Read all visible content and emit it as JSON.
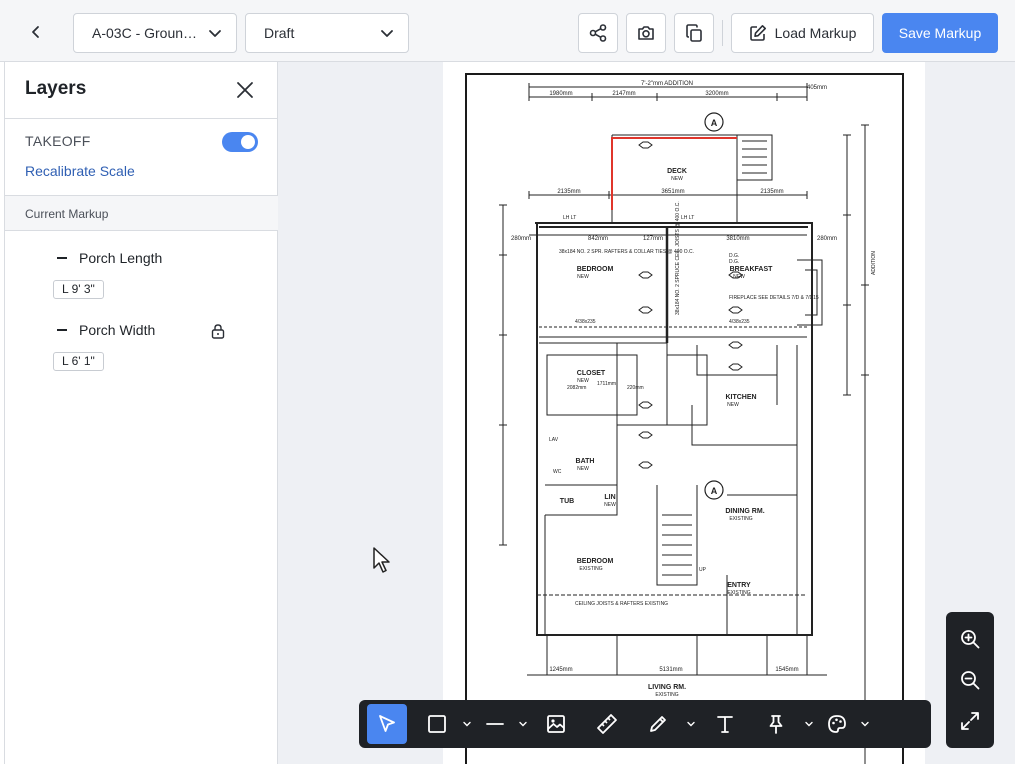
{
  "header": {
    "sheet_select": "A-03C - Groun…",
    "status_select": "Draft",
    "load_label": "Load Markup",
    "save_label": "Save Markup"
  },
  "panel": {
    "title": "Layers",
    "takeoff_label": "TAKEOFF",
    "takeoff_enabled": true,
    "recalibrate_label": "Recalibrate Scale",
    "section_label": "Current Markup",
    "markups": [
      {
        "name": "Porch Length",
        "measure": "L 9' 3\"",
        "locked": false
      },
      {
        "name": "Porch Width",
        "measure": "L 6' 1\"",
        "locked": true
      }
    ]
  },
  "drawing": {
    "dims_top": [
      "7'-2\"mm ADDITION",
      "1980mm",
      "2147mm",
      "3200mm",
      "405mm",
      "2135mm",
      "3651mm",
      "2135mm",
      "842mm",
      "3810mm",
      "127mm",
      "280mm",
      "280mm",
      "1245mm",
      "5131mm",
      "1545mm"
    ],
    "rooms": [
      "DECK",
      "BEDROOM",
      "BREAKFAST",
      "CLOSET",
      "KITCHEN",
      "BATH",
      "LIN",
      "TUB",
      "DINING RM.",
      "BEDROOM",
      "ENTRY",
      "LIVING RM."
    ],
    "room_subs": [
      "NEW",
      "NEW",
      "NEW",
      "NEW",
      "NEW",
      "NEW",
      "NEW",
      "EXISTING",
      "EXISTING",
      "EXISTING",
      "EXISTING"
    ],
    "notes": [
      "38x184 NO. 2 SPR. RAFTERS & COLLAR TIES @ 400 O.C.",
      "38x184 NO. 2 SPRUCE CEIL. JOISTS @ 400 O.C.",
      "FIREPLACE SEE DETAILS 7/D & 7/D15",
      "CEILING JOISTS & RAFTERS EXISTING",
      "4/38x235",
      "4/38x235",
      "2082mm",
      "1711mm",
      "220mm",
      "LH LT",
      "LH LT",
      "D.G.",
      "D.G.",
      "LAV",
      "WC",
      "UP",
      "ADDITION"
    ],
    "section_marker": "A",
    "markup_color": "#e0352b"
  },
  "zoom": {
    "in_icon": "zoom-in-icon",
    "out_icon": "zoom-out-icon",
    "fit_icon": "fullscreen-icon"
  },
  "toolbar": {
    "tools": [
      "select-arrow-icon",
      "rectangle-icon",
      "line-icon",
      "image-icon",
      "ruler-icon",
      "pencil-icon",
      "text-icon",
      "pin-icon",
      "palette-icon"
    ],
    "active": "select-arrow-icon"
  },
  "colors": {
    "accent": "#4a86f0",
    "toolbar_bg": "#1f2226",
    "canvas_bg": "#eef0f4"
  }
}
